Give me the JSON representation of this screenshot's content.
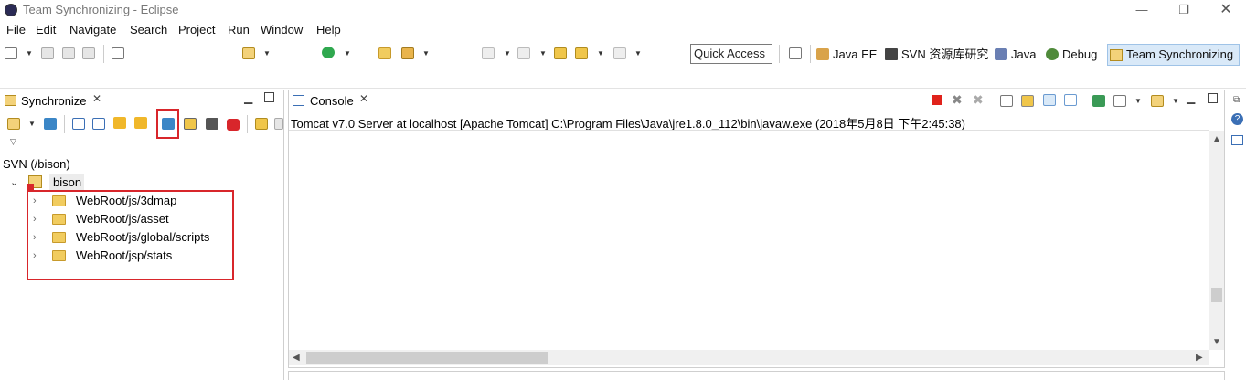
{
  "window": {
    "title": "Team Synchronizing - Eclipse",
    "minimize": "—",
    "maximize": "❐",
    "close": "✕"
  },
  "menu": [
    "File",
    "Edit",
    "Navigate",
    "Search",
    "Project",
    "Run",
    "Window",
    "Help"
  ],
  "toolbar": {
    "quick_access": "Quick Access",
    "perspectives": [
      {
        "label": "Java EE",
        "icon": "java-ee-icon"
      },
      {
        "label": "SVN 资源库研究",
        "icon": "svn-icon"
      },
      {
        "label": "Java",
        "icon": "java-icon"
      },
      {
        "label": "Debug",
        "icon": "debug-icon"
      },
      {
        "label": "Team Synchronizing",
        "icon": "team-sync-icon"
      }
    ]
  },
  "sync_view": {
    "tab_label": "Synchronize",
    "tab_close": "✕",
    "repo_label": "SVN (/bison)",
    "root": "bison",
    "items": [
      "WebRoot/js/3dmap",
      "WebRoot/js/asset",
      "WebRoot/js/global/scripts",
      "WebRoot/jsp/stats"
    ]
  },
  "console_view": {
    "tab_label": "Console",
    "tab_close": "✕",
    "header": "Tomcat v7.0 Server at localhost [Apache Tomcat] C:\\Program Files\\Java\\jre1.8.0_112\\bin\\javaw.exe (2018年5月8日 下午2:45:38)"
  },
  "colors": {
    "highlight_red": "#d8262b",
    "active_perspective": "#d9e9f8",
    "folder": "#f1cc5f",
    "stop_red": "#e0221b"
  }
}
